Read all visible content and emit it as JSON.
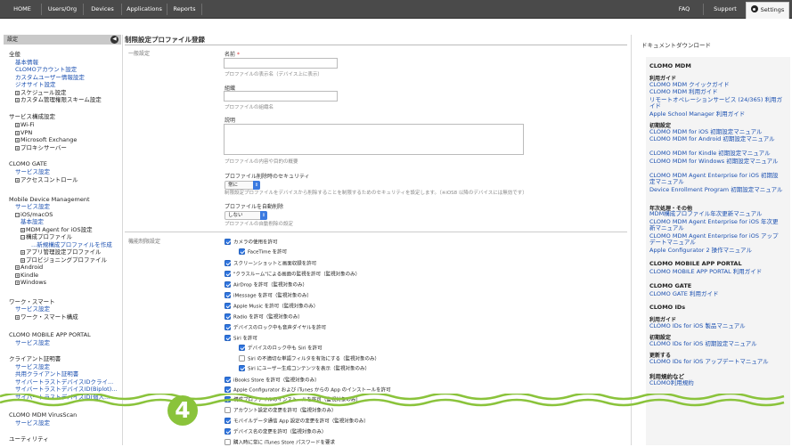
{
  "topnav": {
    "items": [
      "HOME",
      "Users/Org",
      "Devices",
      "Applications",
      "Reports"
    ],
    "faq": "FAQ",
    "support": "Support",
    "settings": "Settings"
  },
  "sidebar": {
    "header": "設定",
    "lines": [
      {
        "text": "全般",
        "type": "head"
      },
      {
        "text": "基本情報",
        "type": "link"
      },
      {
        "text": "CLOMOアカウント設定",
        "type": "link"
      },
      {
        "text": "カスタムユーザー情報設定",
        "type": "link"
      },
      {
        "text": "ジオサイト設定",
        "type": "link"
      },
      {
        "text": "スケジュール設定",
        "type": "tree"
      },
      {
        "text": "カスタム管理権限スキーム設定",
        "type": "tree"
      },
      {
        "text": "サービス構成設定",
        "type": "head"
      },
      {
        "text": "Wi-Fi",
        "type": "tree"
      },
      {
        "text": "VPN",
        "type": "tree"
      },
      {
        "text": "Microsoft Exchange",
        "type": "tree"
      },
      {
        "text": "プロキシサーバー",
        "type": "tree"
      },
      {
        "text": "CLOMO GATE",
        "type": "head"
      },
      {
        "text": "サービス設定",
        "type": "link"
      },
      {
        "text": "アクセスコントロール",
        "type": "tree"
      },
      {
        "text": "Mobile Device Management",
        "type": "head"
      },
      {
        "text": "サービス設定",
        "type": "link"
      },
      {
        "text": "iOS/macOS",
        "type": "tree-open"
      },
      {
        "text": "基本設定",
        "type": "link"
      },
      {
        "text": "MDM Agent for iOS設定",
        "type": "tree"
      },
      {
        "text": "構成プロファイル",
        "type": "tree-open"
      },
      {
        "text": "...新規構成プロファイルを作成",
        "type": "link"
      },
      {
        "text": "アプリ管理設定プロファイル",
        "type": "tree"
      },
      {
        "text": "プロビジョニングプロファイル",
        "type": "tree"
      },
      {
        "text": "Android",
        "type": "tree"
      },
      {
        "text": "Kindle",
        "type": "tree"
      },
      {
        "text": "Windows",
        "type": "tree"
      },
      {
        "text": "ワーク・スマート",
        "type": "head"
      },
      {
        "text": "サービス設定",
        "type": "link"
      },
      {
        "text": "ワーク・スマート構成",
        "type": "tree"
      },
      {
        "text": "CLOMO MOBILE APP PORTAL",
        "type": "head"
      },
      {
        "text": "サービス設定",
        "type": "link"
      },
      {
        "text": "クライアント証明書",
        "type": "head"
      },
      {
        "text": "サービス設定",
        "type": "link"
      },
      {
        "text": "共用クライアント証明書",
        "type": "link"
      },
      {
        "text": "サイバートラストデバイスIDクライ...",
        "type": "link"
      },
      {
        "text": "サイバートラストデバイスID(Biplot)...",
        "type": "link"
      },
      {
        "text": "サイバートラストデバイスID(個人...",
        "type": "link"
      },
      {
        "text": "CLOMO MDM VirusScan",
        "type": "head"
      },
      {
        "text": "サービス設定",
        "type": "link"
      },
      {
        "text": "ユーティリティ",
        "type": "head"
      }
    ]
  },
  "main": {
    "title": "制限設定プロファイル登録",
    "general_label": "一般設定",
    "name_label": "名前",
    "name_required": "*",
    "name_help": "プロファイルの表示名（デバイス上に表示）",
    "org_label": "組織",
    "org_help": "プロファイルの組織名",
    "desc_label": "説明",
    "desc_help": "プロファイルの内容や目的の概要",
    "security_label": "プロファイル削除時のセキュリティ",
    "security_value": "常に",
    "security_help": "制限設定プロファイルをデバイスから削除することを制限するためのセキュリティを設定します。（※iOS8 以降のデバイスには無効です）",
    "autodel_label": "プロファイルを自動削除",
    "autodel_value": "しない",
    "autodel_help": "プロファイルの自動削除の設定",
    "func_label": "機能制限設定",
    "checks": [
      {
        "text": "カメラの使用を許可",
        "on": true,
        "lvl": 0
      },
      {
        "text": "FaceTime を許可",
        "on": true,
        "lvl": 1
      },
      {
        "text": "スクリーンショットと画面収録を許可",
        "on": true,
        "lvl": 0
      },
      {
        "text": "\"クラスルーム\"による画面の監視を許可（監視対象のみ）",
        "on": true,
        "lvl": 0
      },
      {
        "text": "AirDrop を許可（監視対象のみ）",
        "on": true,
        "lvl": 0
      },
      {
        "text": "iMessage を許可（監視対象のみ）",
        "on": true,
        "lvl": 0
      },
      {
        "text": "Apple Music を許可（監視対象のみ）",
        "on": true,
        "lvl": 0
      },
      {
        "text": "Radio を許可（監視対象のみ）",
        "on": true,
        "lvl": 0
      },
      {
        "text": "デバイスのロック中も音声ダイヤルを許可",
        "on": true,
        "lvl": 0
      },
      {
        "text": "Siri を許可",
        "on": true,
        "lvl": 0
      },
      {
        "text": "デバイスのロック中も Siri を許可",
        "on": true,
        "lvl": 1
      },
      {
        "text": "Siri の不適切な単語フィルタを有効にする（監視対象のみ）",
        "on": false,
        "lvl": 1
      },
      {
        "text": "Siri にユーザー生成コンテンツを表示（監視対象のみ）",
        "on": true,
        "lvl": 1
      },
      {
        "text": "iBooks Store を許可（監視対象のみ）",
        "on": true,
        "lvl": 0
      },
      {
        "text": "Apple Configurator および iTunes からの App のインストールを許可",
        "on": true,
        "lvl": 0
      },
      {
        "text": "構成プロファイルのインストールを許可（監視対象のみ）",
        "on": true,
        "lvl": 0
      },
      {
        "text": "アカウント設定の変更を許可（監視対象のみ）",
        "on": false,
        "lvl": 0
      },
      {
        "text": "モバイルデータ通信 App 設定の変更を許可（監視対象のみ）",
        "on": true,
        "lvl": 0
      },
      {
        "text": "デバイス名の変更を許可（監視対象のみ）",
        "on": true,
        "lvl": 0
      },
      {
        "text": "購入時に常に iTunes Store パスワードを要求",
        "on": false,
        "lvl": 0
      }
    ]
  },
  "docs": {
    "title": "ドキュメントダウンロード",
    "entries": [
      {
        "text": "CLOMO MDM",
        "type": "head"
      },
      {
        "text": "利用ガイド",
        "type": "sub"
      },
      {
        "text": "CLOMO MDM クイックガイド",
        "type": "link"
      },
      {
        "text": "CLOMO MDM 利用ガイド",
        "type": "link"
      },
      {
        "text": "リモートオペレーションサービス (24/365) 利用ガイド",
        "type": "link2"
      },
      {
        "text": "Apple School Manager 利用ガイド",
        "type": "link"
      },
      {
        "text": "初期設定",
        "type": "sub"
      },
      {
        "text": "CLOMO MDM for iOS 初期設定マニュアル",
        "type": "link"
      },
      {
        "text": "CLOMO MDM for Android 初期設定マニュアル",
        "type": "link2"
      },
      {
        "text": "CLOMO MDM for Kindle 初期設定マニュアル",
        "type": "link"
      },
      {
        "text": "CLOMO MDM for Windows 初期設定マニュアル",
        "type": "link2"
      },
      {
        "text": "CLOMO MDM Agent Enterprise for iOS 初期設定マニュアル",
        "type": "link2"
      },
      {
        "text": "Device Enrollment Program 初期設定マニュアル",
        "type": "link2"
      },
      {
        "text": "年次処理・その他",
        "type": "sub"
      },
      {
        "text": "MDM構成プロファイル年次更新マニュアル",
        "type": "link"
      },
      {
        "text": "CLOMO MDM Agent Enterprise for iOS 年次更新マニュアル",
        "type": "link2"
      },
      {
        "text": "CLOMO MDM Agent Enterprise for iOS アップデートマニュアル",
        "type": "link2"
      },
      {
        "text": "Apple Configurator 2 操作マニュアル",
        "type": "link"
      },
      {
        "text": "CLOMO MOBILE APP PORTAL",
        "type": "head"
      },
      {
        "text": "CLOMO MOBILE APP PORTAL 利用ガイド",
        "type": "link"
      },
      {
        "text": "CLOMO GATE",
        "type": "head"
      },
      {
        "text": "CLOMO GATE 利用ガイド",
        "type": "link"
      },
      {
        "text": "CLOMO IDs",
        "type": "head"
      },
      {
        "text": "利用ガイド",
        "type": "sub"
      },
      {
        "text": "CLOMO IDs for iOS 製品マニュアル",
        "type": "link"
      },
      {
        "text": "初期設定",
        "type": "sub"
      },
      {
        "text": "CLOMO IDs for iOS 初期設定マニュアル",
        "type": "link"
      },
      {
        "text": "更新する",
        "type": "sub"
      },
      {
        "text": "CLOMO IDs for iOS アップデートマニュアル",
        "type": "link"
      },
      {
        "text": "利用規約など",
        "type": "head"
      },
      {
        "text": "CLOMO利用規約",
        "type": "link"
      }
    ]
  },
  "badge": {
    "number": "4",
    "color": "#8ac33b"
  }
}
